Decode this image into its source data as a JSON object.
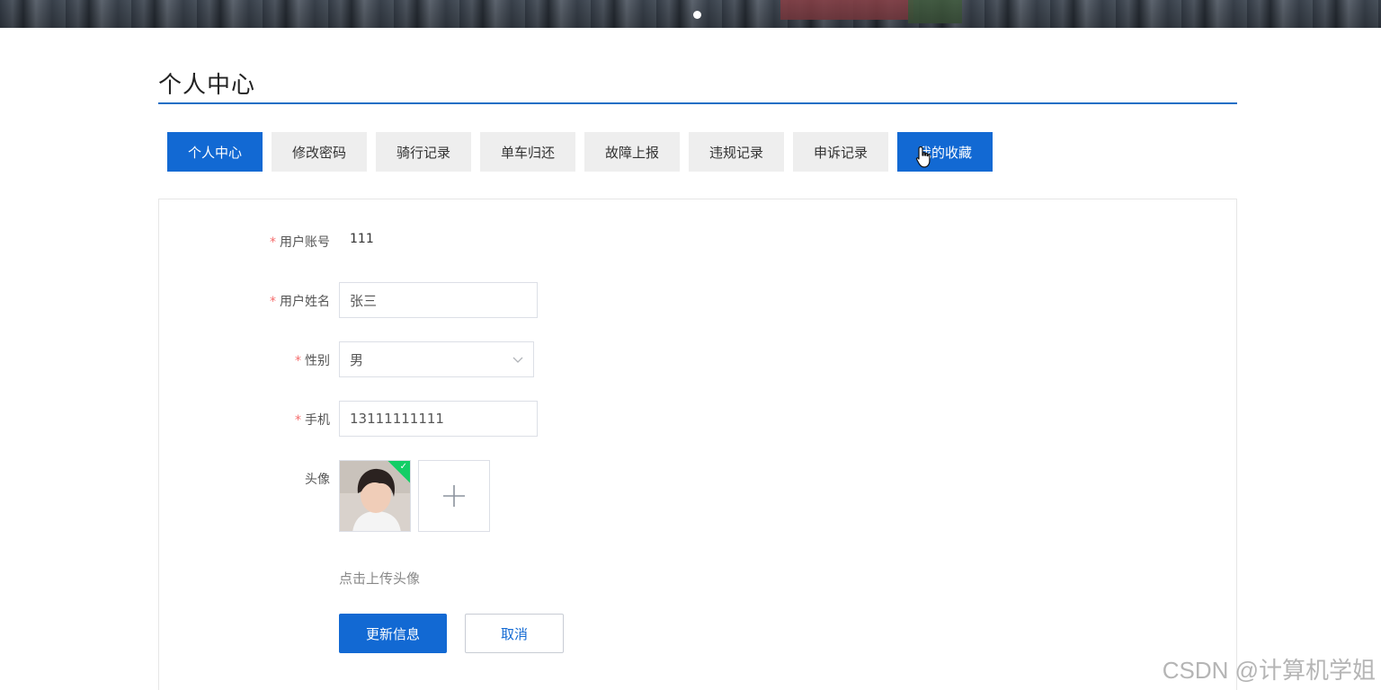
{
  "page": {
    "title": "个人中心"
  },
  "tabs": [
    {
      "label": "个人中心",
      "active": true
    },
    {
      "label": "修改密码",
      "active": false
    },
    {
      "label": "骑行记录",
      "active": false
    },
    {
      "label": "单车归还",
      "active": false
    },
    {
      "label": "故障上报",
      "active": false
    },
    {
      "label": "违规记录",
      "active": false
    },
    {
      "label": "申诉记录",
      "active": false
    },
    {
      "label": "我的收藏",
      "active": false,
      "hovered": true
    }
  ],
  "form": {
    "account": {
      "label": "用户账号",
      "required": true,
      "value": "111"
    },
    "name": {
      "label": "用户姓名",
      "required": true,
      "value": "张三"
    },
    "gender": {
      "label": "性别",
      "required": true,
      "value": "男"
    },
    "phone": {
      "label": "手机",
      "required": true,
      "value": "13111111111"
    },
    "avatar": {
      "label": "头像",
      "required": false,
      "upload_hint": "点击上传头像"
    }
  },
  "actions": {
    "update_label": "更新信息",
    "cancel_label": "取消"
  },
  "watermark": "CSDN @计算机学姐",
  "colors": {
    "primary": "#1269d3",
    "required": "#f56c6c",
    "upload_success": "#13ce66"
  }
}
